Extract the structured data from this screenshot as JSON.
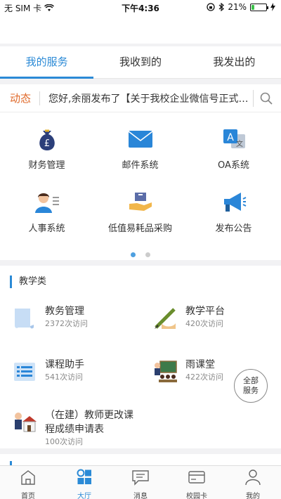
{
  "status_bar": {
    "carrier": "无 SIM 卡",
    "time": "下午4:36",
    "battery": "21%",
    "battery_level": 0.21
  },
  "tabs": [
    {
      "label": "我的服务",
      "active": true
    },
    {
      "label": "我收到的",
      "active": false
    },
    {
      "label": "我发出的",
      "active": false
    }
  ],
  "news": {
    "tag": "动态",
    "text": "您好,余丽发布了【关于我校企业微信号正式上线的通知】"
  },
  "services": [
    {
      "label": "财务管理",
      "icon": "money-bag-icon"
    },
    {
      "label": "邮件系统",
      "icon": "envelope-icon"
    },
    {
      "label": "OA系统",
      "icon": "translate-icon"
    },
    {
      "label": "人事系统",
      "icon": "person-card-icon"
    },
    {
      "label": "低值易耗品采购",
      "icon": "hand-box-icon"
    },
    {
      "label": "发布公告",
      "icon": "megaphone-icon"
    }
  ],
  "pager": {
    "total": 2,
    "current": 0
  },
  "teaching": {
    "title": "教学类",
    "apps": [
      {
        "name": "教务管理",
        "count": "2372次访问",
        "icon": "scroll-icon"
      },
      {
        "name": "教学平台",
        "count": "420次访问",
        "icon": "pen-icon"
      },
      {
        "name": "课程助手",
        "count": "541次访问",
        "icon": "list-icon"
      },
      {
        "name": "雨课堂",
        "count": "422次访问",
        "icon": "classroom-icon"
      },
      {
        "name_line1": "（在建）教师更改课",
        "name_line2": "程成绩申请表",
        "count": "100次访问",
        "icon": "teacher-home-icon"
      }
    ],
    "all_button": {
      "line1": "全部",
      "line2": "服务"
    }
  },
  "tabbar": [
    {
      "label": "首页",
      "icon": "home-icon",
      "active": false
    },
    {
      "label": "大厅",
      "icon": "grid-icon",
      "active": true
    },
    {
      "label": "消息",
      "icon": "message-icon",
      "active": false
    },
    {
      "label": "校园卡",
      "icon": "card-icon",
      "active": false
    },
    {
      "label": "我的",
      "icon": "user-icon",
      "active": false
    }
  ],
  "colors": {
    "accent": "#2b8ad6",
    "news_tag": "#e06a2b"
  }
}
